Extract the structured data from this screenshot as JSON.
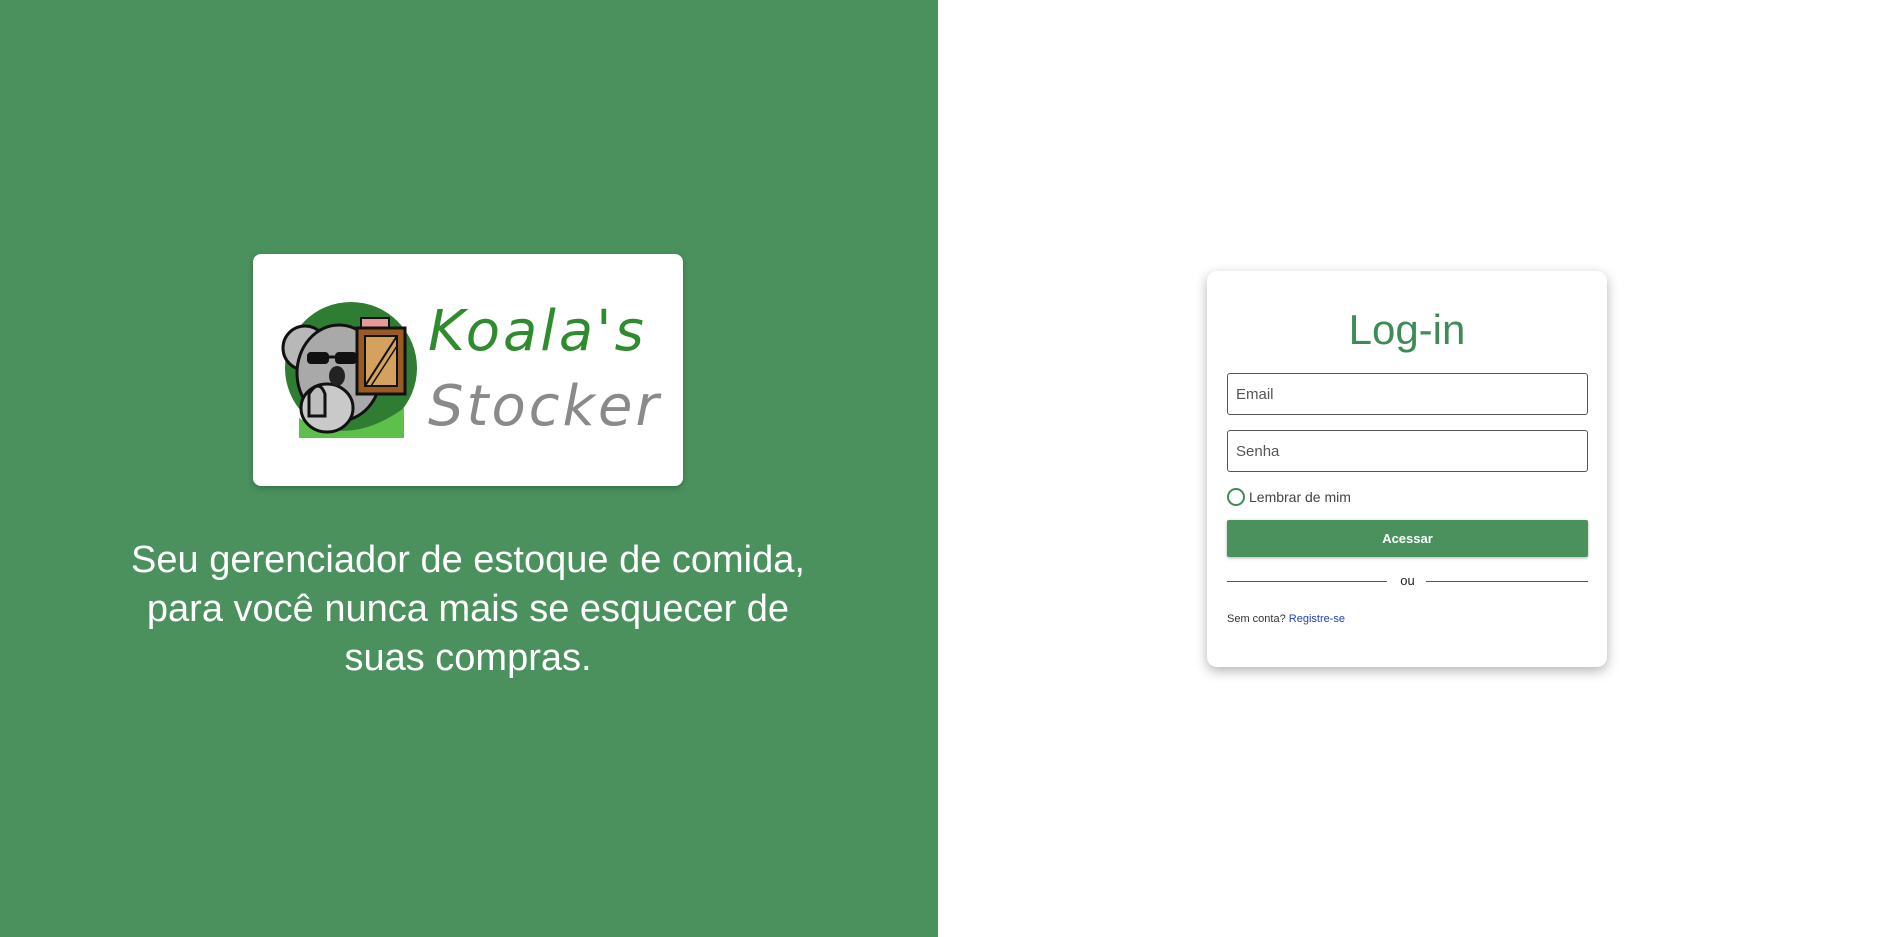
{
  "brand": {
    "line1": "Koala's",
    "line2": "Stocker",
    "colors": {
      "primary_green": "#4a915e",
      "logo_green": "#2e8b2e",
      "logo_gray": "#8a8a8a"
    },
    "mascot_icon": "koala-with-box-icon"
  },
  "tagline": "Seu gerenciador de estoque de comida, para você nunca mais se esquecer de suas compras.",
  "login": {
    "title": "Log-in",
    "email_placeholder": "Email",
    "password_placeholder": "Senha",
    "remember_label": "Lembrar de mim",
    "submit_label": "Acessar",
    "divider_text": "ou",
    "signup_prompt": "Sem conta?",
    "signup_link": "Registre-se"
  }
}
